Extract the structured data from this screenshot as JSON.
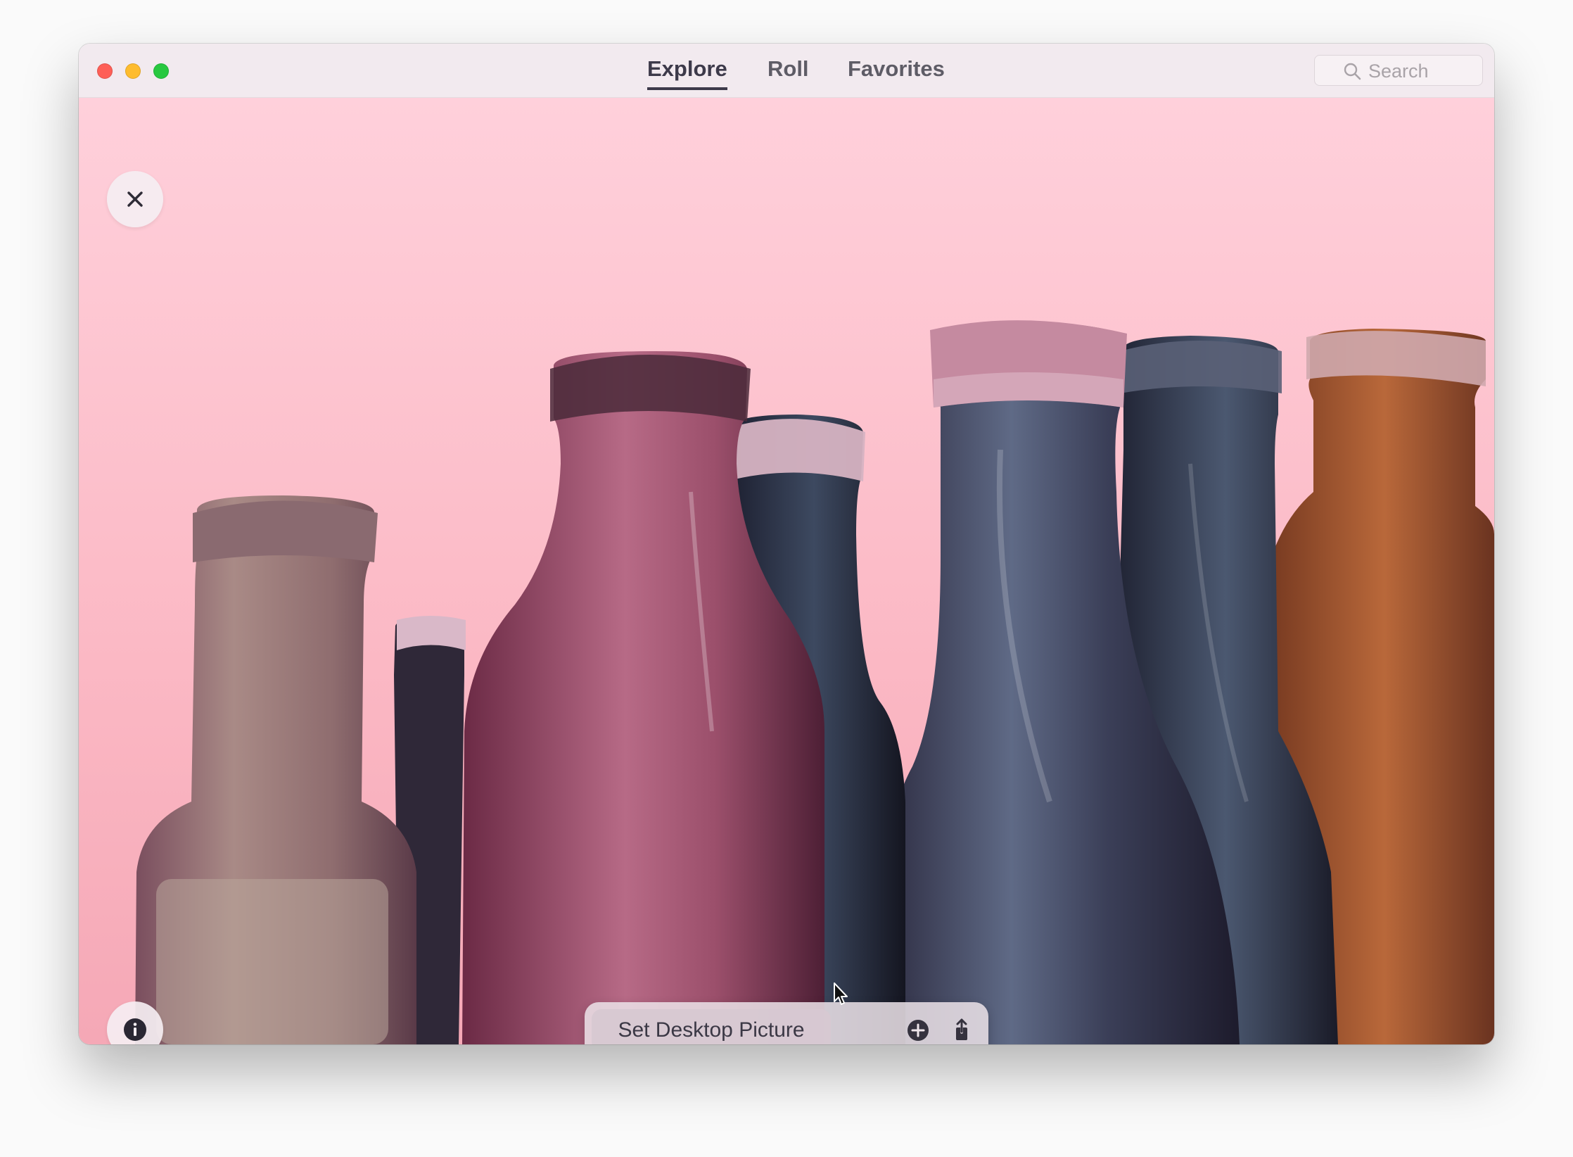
{
  "window": {
    "controls": {
      "close_color": "#fe5f57",
      "minimize_color": "#febc2e",
      "maximize_color": "#28c840"
    }
  },
  "tabs": [
    {
      "label": "Explore",
      "active": true
    },
    {
      "label": "Roll",
      "active": false
    },
    {
      "label": "Favorites",
      "active": false
    }
  ],
  "search": {
    "placeholder": "Search",
    "value": "",
    "icon": "magnifier-icon"
  },
  "photo": {
    "subject": "antique-glass-bottles",
    "background_color": "#ffc7d1"
  },
  "overlay": {
    "close_icon": "close-icon",
    "info_icon": "info-icon"
  },
  "action_bar": {
    "set_desktop_label": "Set Desktop Picture",
    "add_icon": "plus-circle-icon",
    "share_icon": "share-icon"
  },
  "colors": {
    "accent_text": "#3d3a4a",
    "titlebar": "#f2eaef"
  }
}
